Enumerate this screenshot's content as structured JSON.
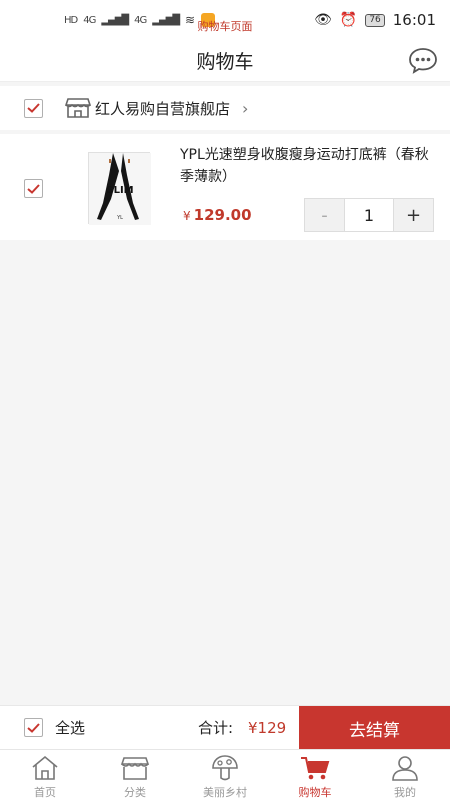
{
  "status_bar": {
    "indicator": "HD",
    "network_left": "4G",
    "network_right": "4G",
    "page_label": "购物车页面",
    "battery": "76",
    "time": "16:01"
  },
  "header": {
    "title": "购物车"
  },
  "store": {
    "name": "红人易购自营旗舰店",
    "checked": true
  },
  "items": [
    {
      "name": "YPL光速塑身收腹瘦身运动打底裤（春秋季薄款）",
      "price": "129.00",
      "currency": "¥",
      "quantity": "1",
      "image_text": "SLIM",
      "checked": true
    }
  ],
  "stepper": {
    "minus": "-",
    "plus": "+"
  },
  "checkout": {
    "select_all": "全选",
    "total_label": "合计:",
    "total_value": "¥129",
    "button": "去结算"
  },
  "tabs": [
    {
      "label": "首页",
      "icon": "home-icon",
      "active": false
    },
    {
      "label": "分类",
      "icon": "category-icon",
      "active": false
    },
    {
      "label": "美丽乡村",
      "icon": "mushroom-icon",
      "active": false
    },
    {
      "label": "购物车",
      "icon": "cart-icon",
      "active": true
    },
    {
      "label": "我的",
      "icon": "profile-icon",
      "active": false
    }
  ],
  "colors": {
    "accent": "#c8362f",
    "price": "#c0392b",
    "background": "#f5f5f5"
  }
}
